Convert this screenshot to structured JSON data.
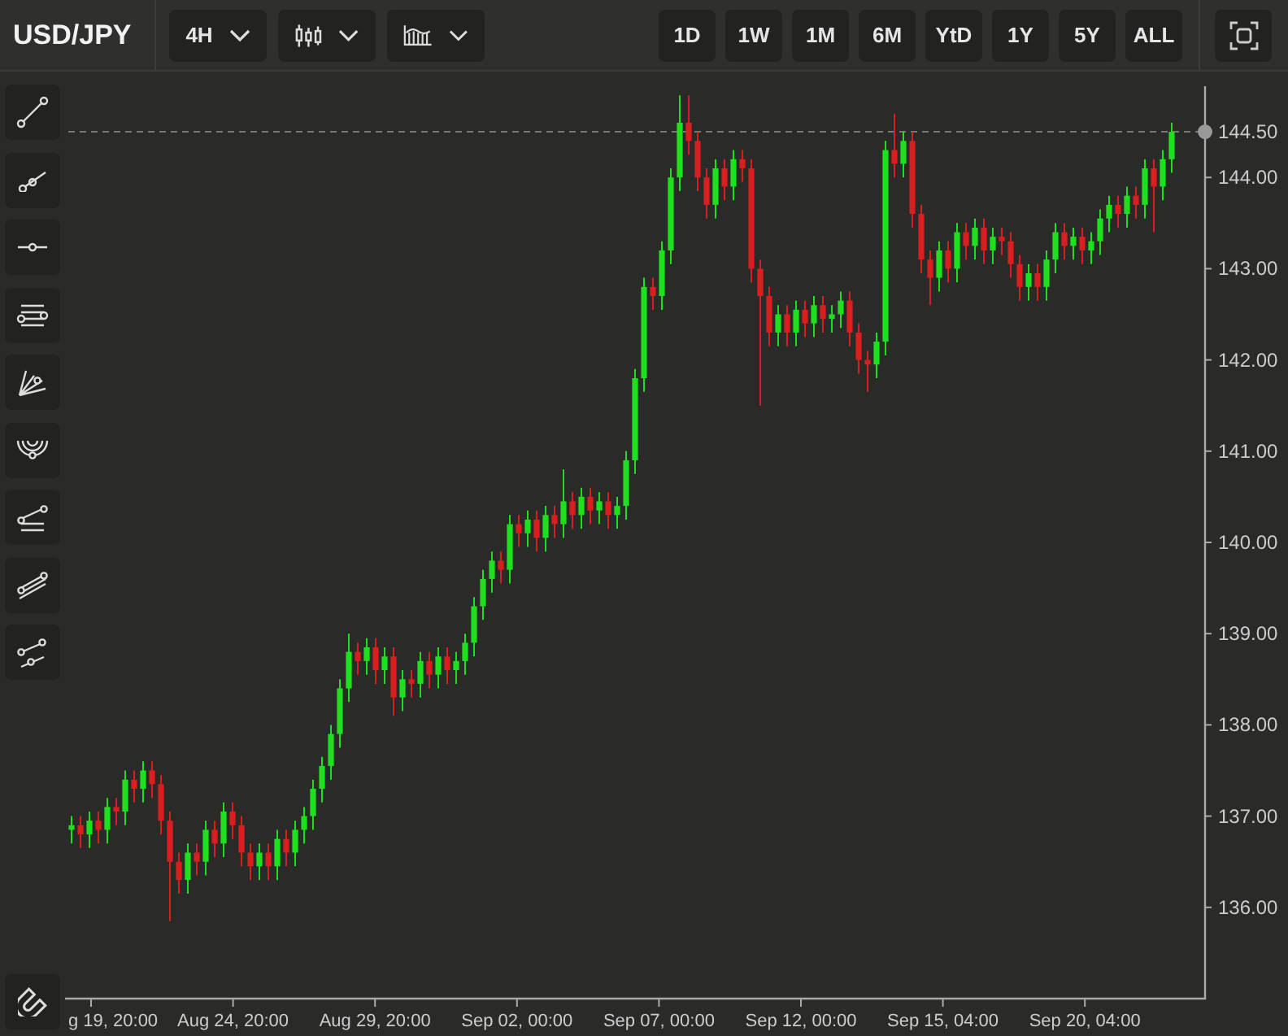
{
  "symbol": "USD/JPY",
  "dropdowns": [
    {
      "kind": "interval",
      "label": "4H"
    },
    {
      "kind": "candles"
    },
    {
      "kind": "area"
    }
  ],
  "ranges": [
    "1D",
    "1W",
    "1M",
    "6M",
    "YtD",
    "1Y",
    "5Y",
    "ALL"
  ],
  "tools": [
    {
      "kind": "trend-line"
    },
    {
      "kind": "ray"
    },
    {
      "kind": "horizontal-line"
    },
    {
      "kind": "parallel-lines"
    },
    {
      "kind": "fan"
    },
    {
      "kind": "arcs"
    },
    {
      "kind": "lines-point"
    },
    {
      "kind": "channel"
    },
    {
      "kind": "two-lines"
    }
  ],
  "chart": {
    "x_labels": [
      "g 19, 20:00",
      "Aug 24, 20:00",
      "Aug 29, 20:00",
      "Sep 02, 00:00",
      "Sep 07, 00:00",
      "Sep 12, 00:00",
      "Sep 15, 04:00",
      "Sep 20, 04:00"
    ],
    "chart_data": {
      "type": "candlestick",
      "ylim": [
        135,
        145
      ],
      "yticks": [
        {
          "value": 144,
          "label": "144.00"
        },
        {
          "value": 143,
          "label": "143.00"
        },
        {
          "value": 142,
          "label": "142.00"
        },
        {
          "value": 141,
          "label": "141.00"
        },
        {
          "value": 140,
          "label": "140.00"
        },
        {
          "value": 139,
          "label": "139.00"
        },
        {
          "value": 138,
          "label": "138.00"
        },
        {
          "value": 137,
          "label": "137.00"
        },
        {
          "value": 136,
          "label": "136.00"
        }
      ],
      "ref_lines": [
        {
          "axis": "y",
          "value": 144.5,
          "label": "144.50"
        }
      ],
      "ohlc": [
        [
          136.85,
          137.0,
          136.7,
          136.9
        ],
        [
          136.9,
          137.0,
          136.65,
          136.8
        ],
        [
          136.8,
          137.05,
          136.65,
          136.95
        ],
        [
          136.95,
          137.05,
          136.7,
          136.85
        ],
        [
          136.85,
          137.2,
          136.7,
          137.1
        ],
        [
          137.1,
          137.2,
          136.9,
          137.05
        ],
        [
          137.05,
          137.5,
          136.9,
          137.4
        ],
        [
          137.4,
          137.5,
          137.15,
          137.3
        ],
        [
          137.3,
          137.6,
          137.15,
          137.5
        ],
        [
          137.5,
          137.6,
          137.2,
          137.35
        ],
        [
          137.35,
          137.45,
          136.8,
          136.95
        ],
        [
          136.95,
          137.05,
          135.85,
          136.5
        ],
        [
          136.5,
          136.6,
          136.15,
          136.3
        ],
        [
          136.3,
          136.7,
          136.15,
          136.6
        ],
        [
          136.6,
          136.7,
          136.35,
          136.5
        ],
        [
          136.5,
          136.95,
          136.35,
          136.85
        ],
        [
          136.85,
          136.95,
          136.55,
          136.7
        ],
        [
          136.7,
          137.15,
          136.55,
          137.05
        ],
        [
          137.05,
          137.15,
          136.75,
          136.9
        ],
        [
          136.9,
          137.0,
          136.45,
          136.6
        ],
        [
          136.6,
          136.7,
          136.3,
          136.45
        ],
        [
          136.45,
          136.7,
          136.3,
          136.6
        ],
        [
          136.6,
          136.7,
          136.3,
          136.45
        ],
        [
          136.45,
          136.85,
          136.3,
          136.75
        ],
        [
          136.75,
          136.85,
          136.45,
          136.6
        ],
        [
          136.6,
          136.95,
          136.45,
          136.85
        ],
        [
          136.85,
          137.1,
          136.7,
          137.0
        ],
        [
          137.0,
          137.4,
          136.85,
          137.3
        ],
        [
          137.3,
          137.65,
          137.15,
          137.55
        ],
        [
          137.55,
          138.0,
          137.4,
          137.9
        ],
        [
          137.9,
          138.5,
          137.75,
          138.4
        ],
        [
          138.4,
          139.0,
          138.25,
          138.8
        ],
        [
          138.8,
          138.9,
          138.55,
          138.7
        ],
        [
          138.7,
          138.95,
          138.55,
          138.85
        ],
        [
          138.85,
          138.95,
          138.45,
          138.6
        ],
        [
          138.6,
          138.85,
          138.45,
          138.75
        ],
        [
          138.75,
          138.85,
          138.1,
          138.3
        ],
        [
          138.3,
          138.6,
          138.15,
          138.5
        ],
        [
          138.5,
          138.6,
          138.3,
          138.45
        ],
        [
          138.45,
          138.8,
          138.3,
          138.7
        ],
        [
          138.7,
          138.8,
          138.4,
          138.55
        ],
        [
          138.55,
          138.85,
          138.4,
          138.75
        ],
        [
          138.75,
          138.85,
          138.45,
          138.6
        ],
        [
          138.6,
          138.8,
          138.45,
          138.7
        ],
        [
          138.7,
          139.0,
          138.55,
          138.9
        ],
        [
          138.9,
          139.4,
          138.75,
          139.3
        ],
        [
          139.3,
          139.7,
          139.15,
          139.6
        ],
        [
          139.6,
          139.9,
          139.45,
          139.8
        ],
        [
          139.8,
          139.9,
          139.55,
          139.7
        ],
        [
          139.7,
          140.3,
          139.55,
          140.2
        ],
        [
          140.2,
          140.3,
          139.95,
          140.1
        ],
        [
          140.1,
          140.35,
          139.95,
          140.25
        ],
        [
          140.25,
          140.35,
          139.9,
          140.05
        ],
        [
          140.05,
          140.4,
          139.9,
          140.3
        ],
        [
          140.3,
          140.4,
          140.05,
          140.2
        ],
        [
          140.2,
          140.8,
          140.05,
          140.45
        ],
        [
          140.45,
          140.55,
          140.15,
          140.3
        ],
        [
          140.3,
          140.6,
          140.15,
          140.5
        ],
        [
          140.5,
          140.6,
          140.2,
          140.35
        ],
        [
          140.35,
          140.55,
          140.2,
          140.45
        ],
        [
          140.45,
          140.55,
          140.15,
          140.3
        ],
        [
          140.3,
          140.5,
          140.15,
          140.4
        ],
        [
          140.4,
          141.0,
          140.25,
          140.9
        ],
        [
          140.9,
          141.9,
          140.75,
          141.8
        ],
        [
          141.8,
          142.9,
          141.65,
          142.8
        ],
        [
          142.8,
          142.9,
          142.55,
          142.7
        ],
        [
          142.7,
          143.3,
          142.55,
          143.2
        ],
        [
          143.2,
          144.1,
          143.05,
          144.0
        ],
        [
          144.0,
          144.9,
          143.85,
          144.6
        ],
        [
          144.6,
          144.9,
          144.25,
          144.4
        ],
        [
          144.4,
          144.5,
          143.85,
          144.0
        ],
        [
          144.0,
          144.1,
          143.55,
          143.7
        ],
        [
          143.7,
          144.2,
          143.55,
          144.1
        ],
        [
          144.1,
          144.2,
          143.75,
          143.9
        ],
        [
          143.9,
          144.3,
          143.75,
          144.2
        ],
        [
          144.2,
          144.3,
          143.95,
          144.1
        ],
        [
          144.1,
          144.2,
          142.85,
          143.0
        ],
        [
          143.0,
          143.1,
          141.5,
          142.7
        ],
        [
          142.7,
          142.8,
          142.15,
          142.3
        ],
        [
          142.3,
          142.6,
          142.15,
          142.5
        ],
        [
          142.5,
          142.6,
          142.15,
          142.3
        ],
        [
          142.3,
          142.65,
          142.15,
          142.55
        ],
        [
          142.55,
          142.65,
          142.25,
          142.4
        ],
        [
          142.4,
          142.7,
          142.25,
          142.6
        ],
        [
          142.6,
          142.7,
          142.3,
          142.45
        ],
        [
          142.45,
          142.6,
          142.3,
          142.5
        ],
        [
          142.5,
          142.75,
          142.35,
          142.65
        ],
        [
          142.65,
          142.75,
          142.15,
          142.3
        ],
        [
          142.3,
          142.4,
          141.85,
          142.0
        ],
        [
          142.0,
          142.1,
          141.65,
          141.95
        ],
        [
          141.95,
          142.3,
          141.8,
          142.2
        ],
        [
          142.2,
          144.4,
          142.05,
          144.3
        ],
        [
          144.3,
          144.7,
          144.0,
          144.15
        ],
        [
          144.15,
          144.5,
          144.0,
          144.4
        ],
        [
          144.4,
          144.5,
          143.45,
          143.6
        ],
        [
          143.6,
          143.7,
          142.95,
          143.1
        ],
        [
          143.1,
          143.2,
          142.6,
          142.9
        ],
        [
          142.9,
          143.3,
          142.75,
          143.2
        ],
        [
          143.2,
          143.3,
          142.85,
          143.0
        ],
        [
          143.0,
          143.5,
          142.85,
          143.4
        ],
        [
          143.4,
          143.5,
          143.1,
          143.25
        ],
        [
          143.25,
          143.55,
          143.1,
          143.45
        ],
        [
          143.45,
          143.55,
          143.05,
          143.2
        ],
        [
          143.2,
          143.45,
          143.05,
          143.35
        ],
        [
          143.35,
          143.45,
          143.15,
          143.3
        ],
        [
          143.3,
          143.4,
          142.9,
          143.05
        ],
        [
          143.05,
          143.15,
          142.65,
          142.8
        ],
        [
          142.8,
          143.05,
          142.65,
          142.95
        ],
        [
          142.95,
          143.05,
          142.65,
          142.8
        ],
        [
          142.8,
          143.2,
          142.65,
          143.1
        ],
        [
          143.1,
          143.5,
          142.95,
          143.4
        ],
        [
          143.4,
          143.5,
          143.1,
          143.25
        ],
        [
          143.25,
          143.45,
          143.1,
          143.35
        ],
        [
          143.35,
          143.45,
          143.05,
          143.2
        ],
        [
          143.2,
          143.4,
          143.05,
          143.3
        ],
        [
          143.3,
          143.65,
          143.15,
          143.55
        ],
        [
          143.55,
          143.8,
          143.4,
          143.7
        ],
        [
          143.7,
          143.8,
          143.45,
          143.6
        ],
        [
          143.6,
          143.9,
          143.45,
          143.8
        ],
        [
          143.8,
          143.9,
          143.55,
          143.7
        ],
        [
          143.7,
          144.2,
          143.55,
          144.1
        ],
        [
          144.1,
          144.2,
          143.4,
          143.9
        ],
        [
          143.9,
          144.3,
          143.75,
          144.2
        ],
        [
          144.2,
          144.6,
          144.05,
          144.5
        ]
      ]
    }
  }
}
